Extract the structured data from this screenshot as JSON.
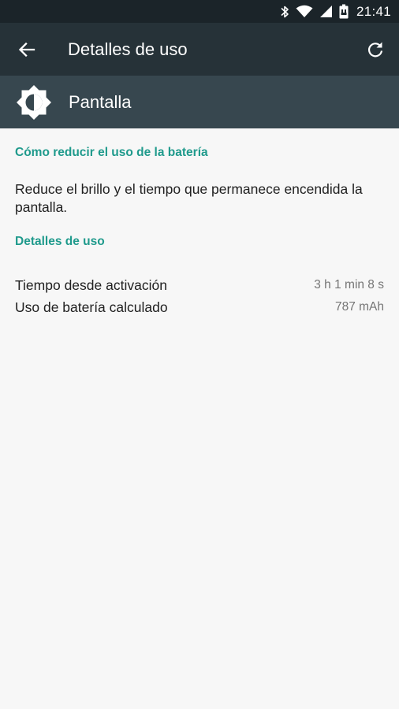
{
  "status_bar": {
    "time": "21:41",
    "icons": [
      "bluetooth-icon",
      "wifi-icon",
      "cell-signal-icon",
      "battery-icon"
    ]
  },
  "app_bar": {
    "title": "Detalles de uso",
    "back_icon": "arrow-back-icon",
    "refresh_icon": "refresh-icon"
  },
  "header": {
    "icon": "brightness-icon",
    "name": "Pantalla"
  },
  "tips_section": {
    "title": "Cómo reducir el uso de la batería",
    "text": "Reduce el brillo y el tiempo que permanece encendida la pantalla."
  },
  "usage_section": {
    "title": "Detalles de uso",
    "rows": [
      {
        "label": "Tiempo desde activación",
        "value": "3 h 1 min 8 s"
      },
      {
        "label": "Uso de batería calculado",
        "value": "787 mAh"
      }
    ]
  },
  "colors": {
    "status_bar": "#1b2429",
    "app_bar": "#263238",
    "header_band": "#37474f",
    "accent": "#1f9a8c",
    "background": "#f7f7f7"
  }
}
